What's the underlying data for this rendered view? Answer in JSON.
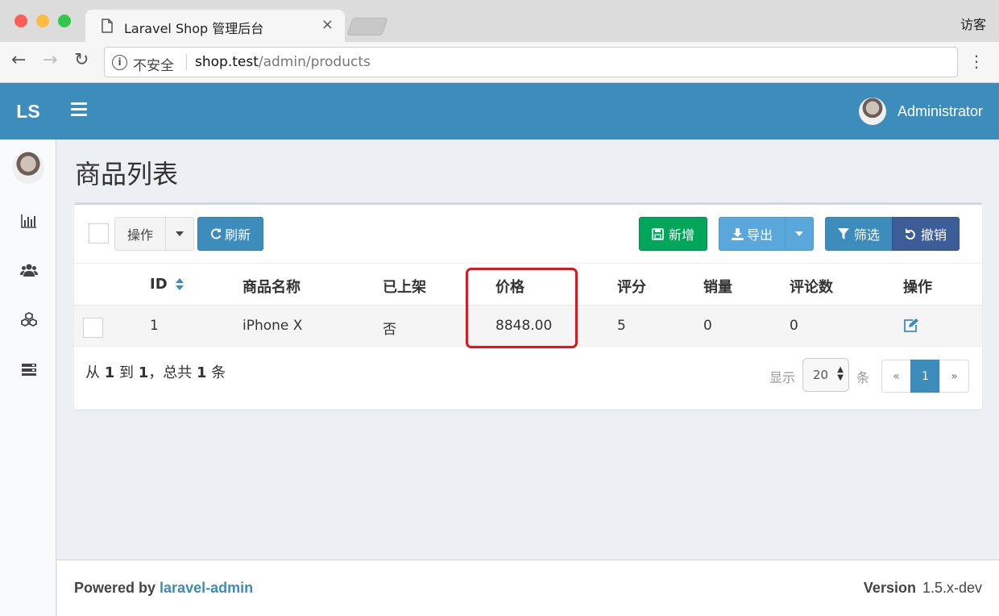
{
  "browser": {
    "tab_title": "Laravel Shop 管理后台",
    "tab_close": "×",
    "guest_label": "访客",
    "security_label": "不安全",
    "url_host": "shop.test",
    "url_path": "/admin/products",
    "nav": {
      "back": "←",
      "forward": "→",
      "reload": "↻",
      "menu": "⋮"
    }
  },
  "header": {
    "logo": "LS",
    "user_name": "Administrator"
  },
  "sidebar": {
    "items": [
      {
        "icon": "bar-chart-icon"
      },
      {
        "icon": "users-icon"
      },
      {
        "icon": "cubes-icon"
      },
      {
        "icon": "server-icon"
      }
    ]
  },
  "page": {
    "title": "商品列表"
  },
  "toolbar": {
    "actions_label": "操作",
    "refresh_label": "刷新",
    "new_label": "新增",
    "export_label": "导出",
    "filter_label": "筛选",
    "reset_label": "撤销"
  },
  "table": {
    "columns": [
      "ID",
      "商品名称",
      "已上架",
      "价格",
      "评分",
      "销量",
      "评论数",
      "操作"
    ],
    "rows": [
      {
        "id": "1",
        "name": "iPhone X",
        "on_sale": "否",
        "price": "8848.00",
        "rating": "5",
        "sold": "0",
        "reviews": "0"
      }
    ]
  },
  "pagination": {
    "info_prefix": "从",
    "from": "1",
    "to_word": "到",
    "to": "1",
    "total_prefix": "，总共",
    "total": "1",
    "unit": "条",
    "per_page_label": "显示",
    "per_page_value": "20",
    "per_page_unit": "条",
    "prev": "«",
    "current_page": "1",
    "next": "»"
  },
  "footer": {
    "powered_prefix": "Powered by",
    "powered_link": "laravel-admin",
    "version_label": "Version",
    "version_value": "1.5.x-dev"
  },
  "colors": {
    "brand": "#3c8dbc",
    "success": "#00a65a",
    "highlight": "#e6141a"
  }
}
